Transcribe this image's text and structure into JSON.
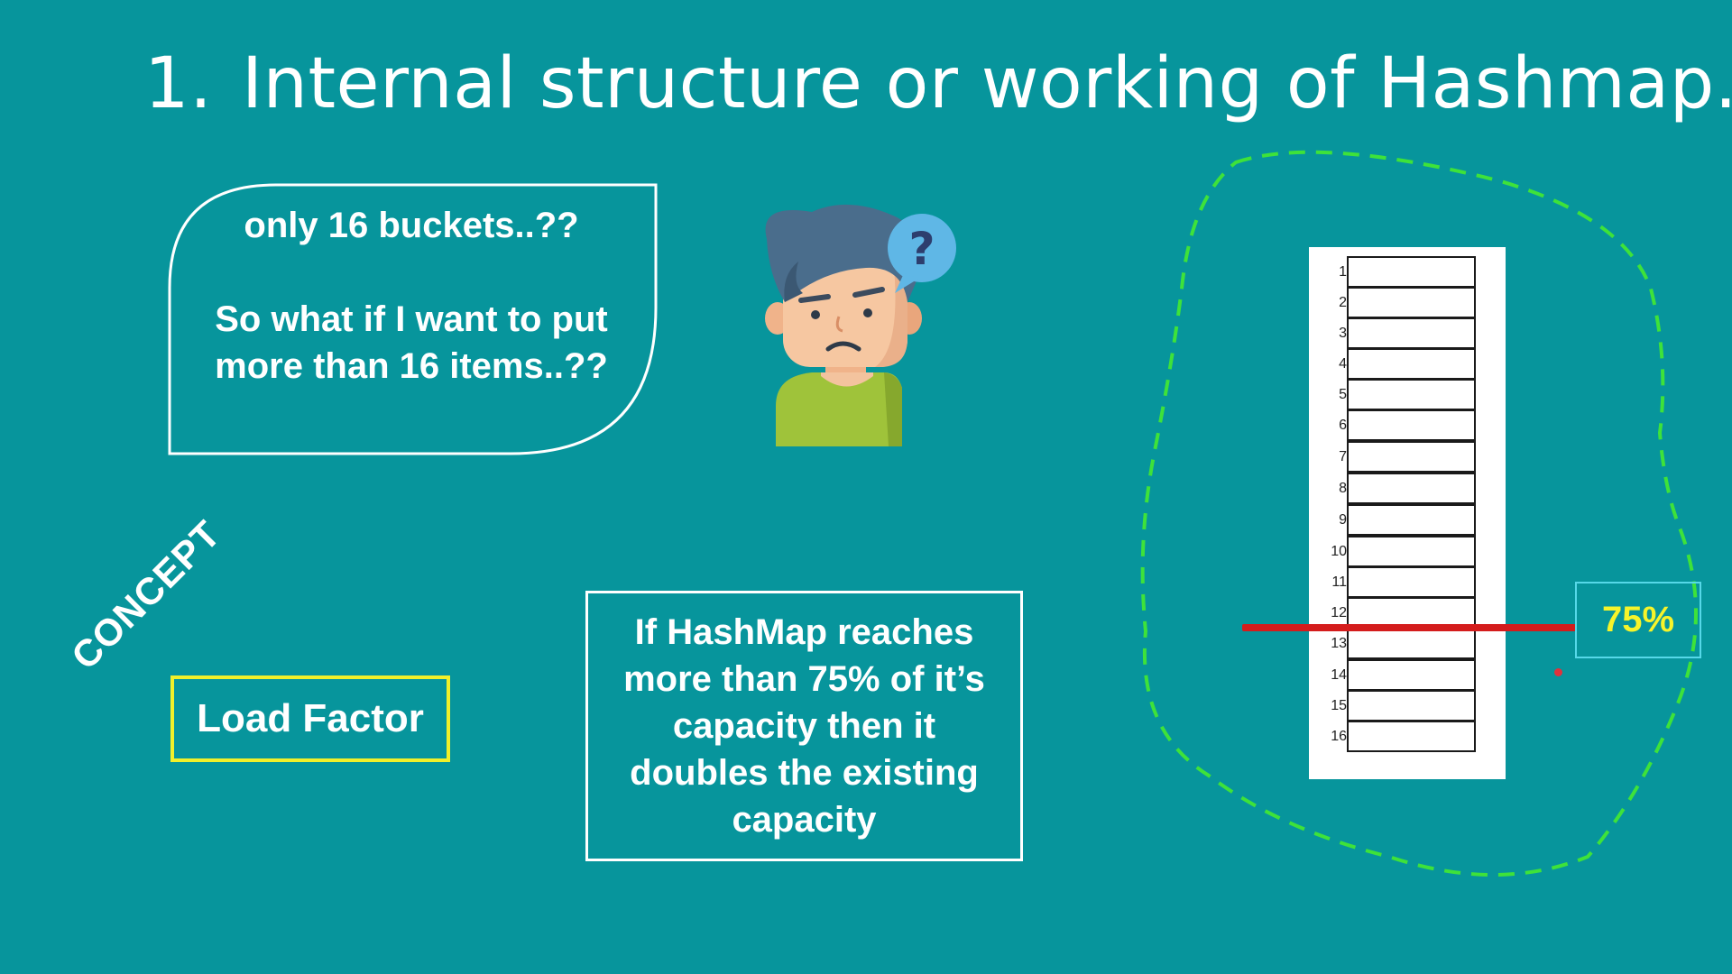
{
  "slide": {
    "title_number": "1.",
    "title_text": "Internal structure or working of Hashmap.",
    "bubble": {
      "line1": "only 16 buckets..??",
      "line2": "So what if I want to put more than 16 items..??"
    },
    "concept_label": "CONCEPT",
    "load_factor_label": "Load Factor",
    "info_text": "If HashMap reaches more than 75% of it’s capacity then it doubles the existing capacity",
    "threshold_percent_label": "75%",
    "buckets": [
      "1",
      "2",
      "3",
      "4",
      "5",
      "6",
      "7",
      "8",
      "9",
      "10",
      "11",
      "12",
      "13",
      "14",
      "15",
      "16"
    ],
    "colors": {
      "background": "#07959c",
      "threshold_line": "#d41c1c",
      "percent_text": "#f6f42a",
      "load_factor_border": "#f0f02a",
      "blob_dash": "#3ee23a"
    },
    "icons": {
      "person": "confused-person-icon",
      "question": "question-mark-icon"
    }
  }
}
